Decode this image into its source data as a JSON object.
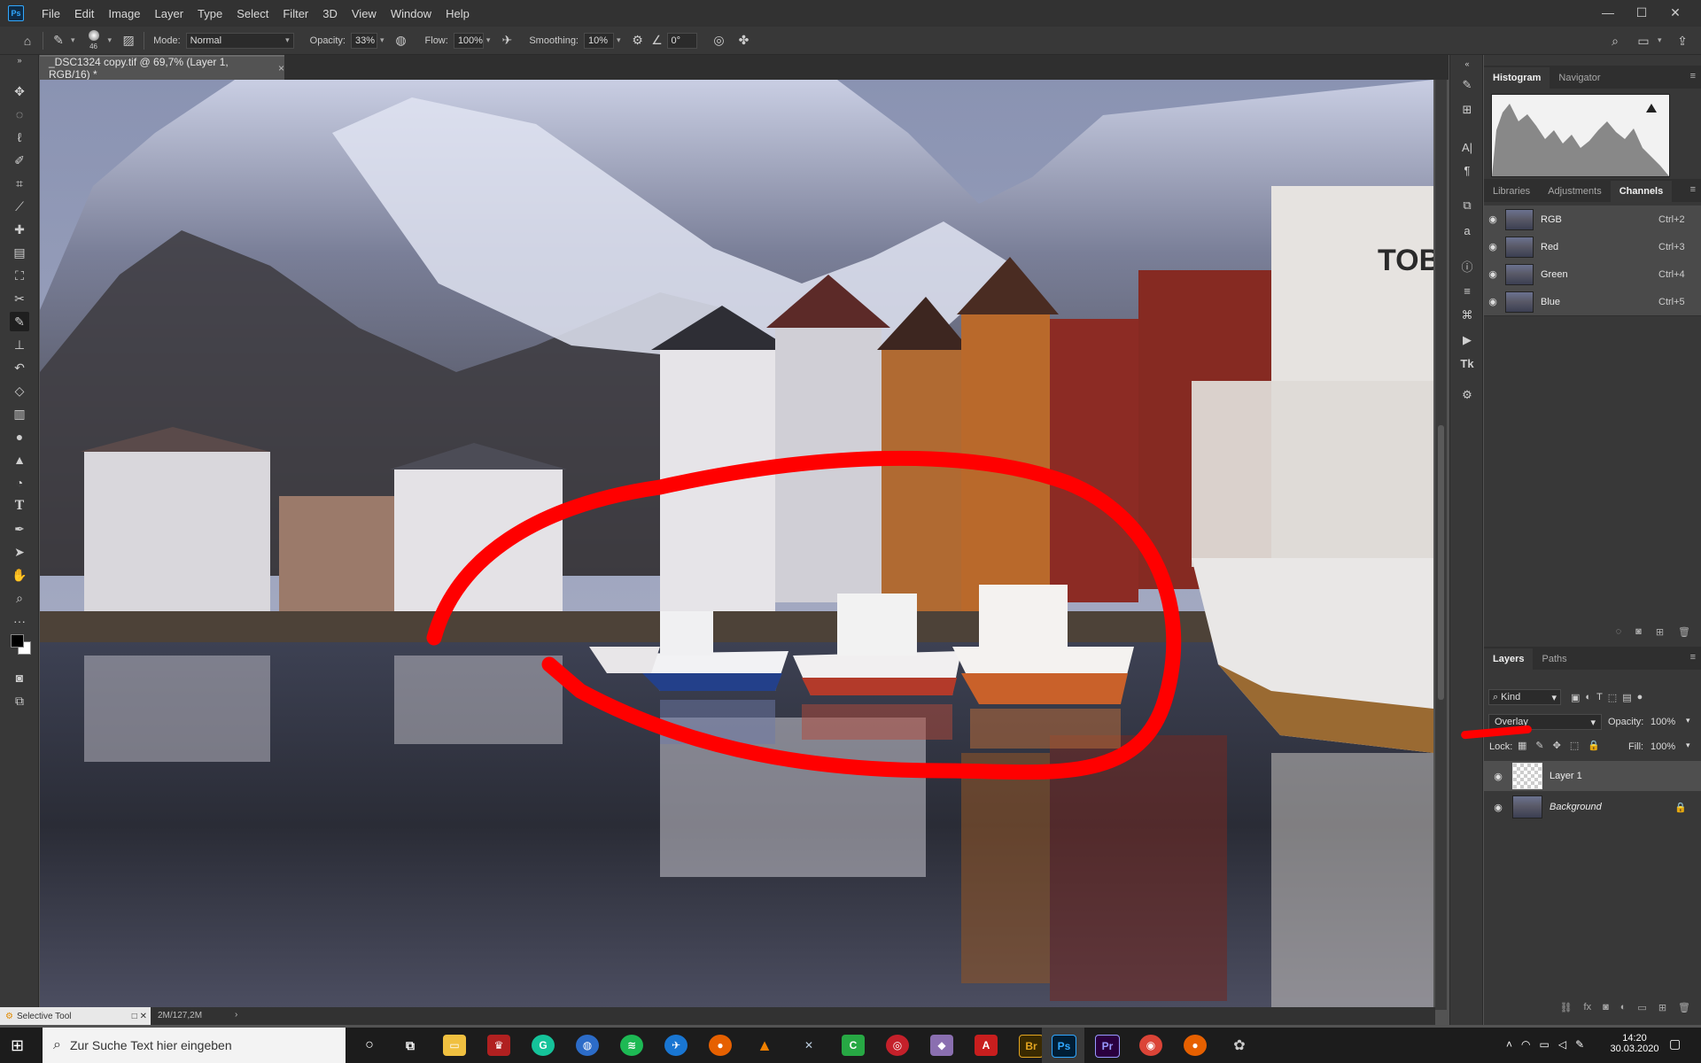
{
  "app": {
    "logo": "Ps",
    "menu": [
      "File",
      "Edit",
      "Image",
      "Layer",
      "Type",
      "Select",
      "Filter",
      "3D",
      "View",
      "Window",
      "Help"
    ],
    "window_controls": [
      "minimize-icon",
      "restore-icon",
      "close-icon"
    ]
  },
  "options_bar": {
    "brush_size": "46",
    "mode_label": "Mode:",
    "mode_value": "Normal",
    "opacity_label": "Opacity:",
    "opacity_value": "33%",
    "flow_label": "Flow:",
    "flow_value": "100%",
    "smoothing_label": "Smoothing:",
    "smoothing_value": "10%",
    "angle_value": "0°"
  },
  "document": {
    "tab_title": "_DSC1324 copy.tif @ 69,7% (Layer 1, RGB/16) *",
    "sign_text": "TOBIASE",
    "status_size": "2M/127,2M"
  },
  "panels": {
    "top_tabs": [
      "Histogram",
      "Navigator"
    ],
    "mid_tabs": [
      "Libraries",
      "Adjustments",
      "Channels"
    ],
    "channels": [
      {
        "name": "RGB",
        "shortcut": "Ctrl+2"
      },
      {
        "name": "Red",
        "shortcut": "Ctrl+3"
      },
      {
        "name": "Green",
        "shortcut": "Ctrl+4"
      },
      {
        "name": "Blue",
        "shortcut": "Ctrl+5"
      }
    ],
    "layer_tabs": [
      "Layers",
      "Paths"
    ],
    "filter_kind": "Kind",
    "blend_mode": "Overlay",
    "opacity_label": "Opacity:",
    "opacity_value": "100%",
    "lock_label": "Lock:",
    "fill_label": "Fill:",
    "fill_value": "100%",
    "layers": [
      {
        "name": "Layer 1"
      },
      {
        "name": "Background"
      }
    ]
  },
  "tool_tooltip": "Selective Tool",
  "taskbar": {
    "search_placeholder": "Zur Suche Text hier eingeben",
    "time": "14:20",
    "date": "30.03.2020",
    "apps": [
      "Br",
      "Ps",
      "Pr"
    ]
  },
  "colors": {
    "annotation_red": "#ff0000",
    "photoshop_blue": "#31a8ff"
  }
}
